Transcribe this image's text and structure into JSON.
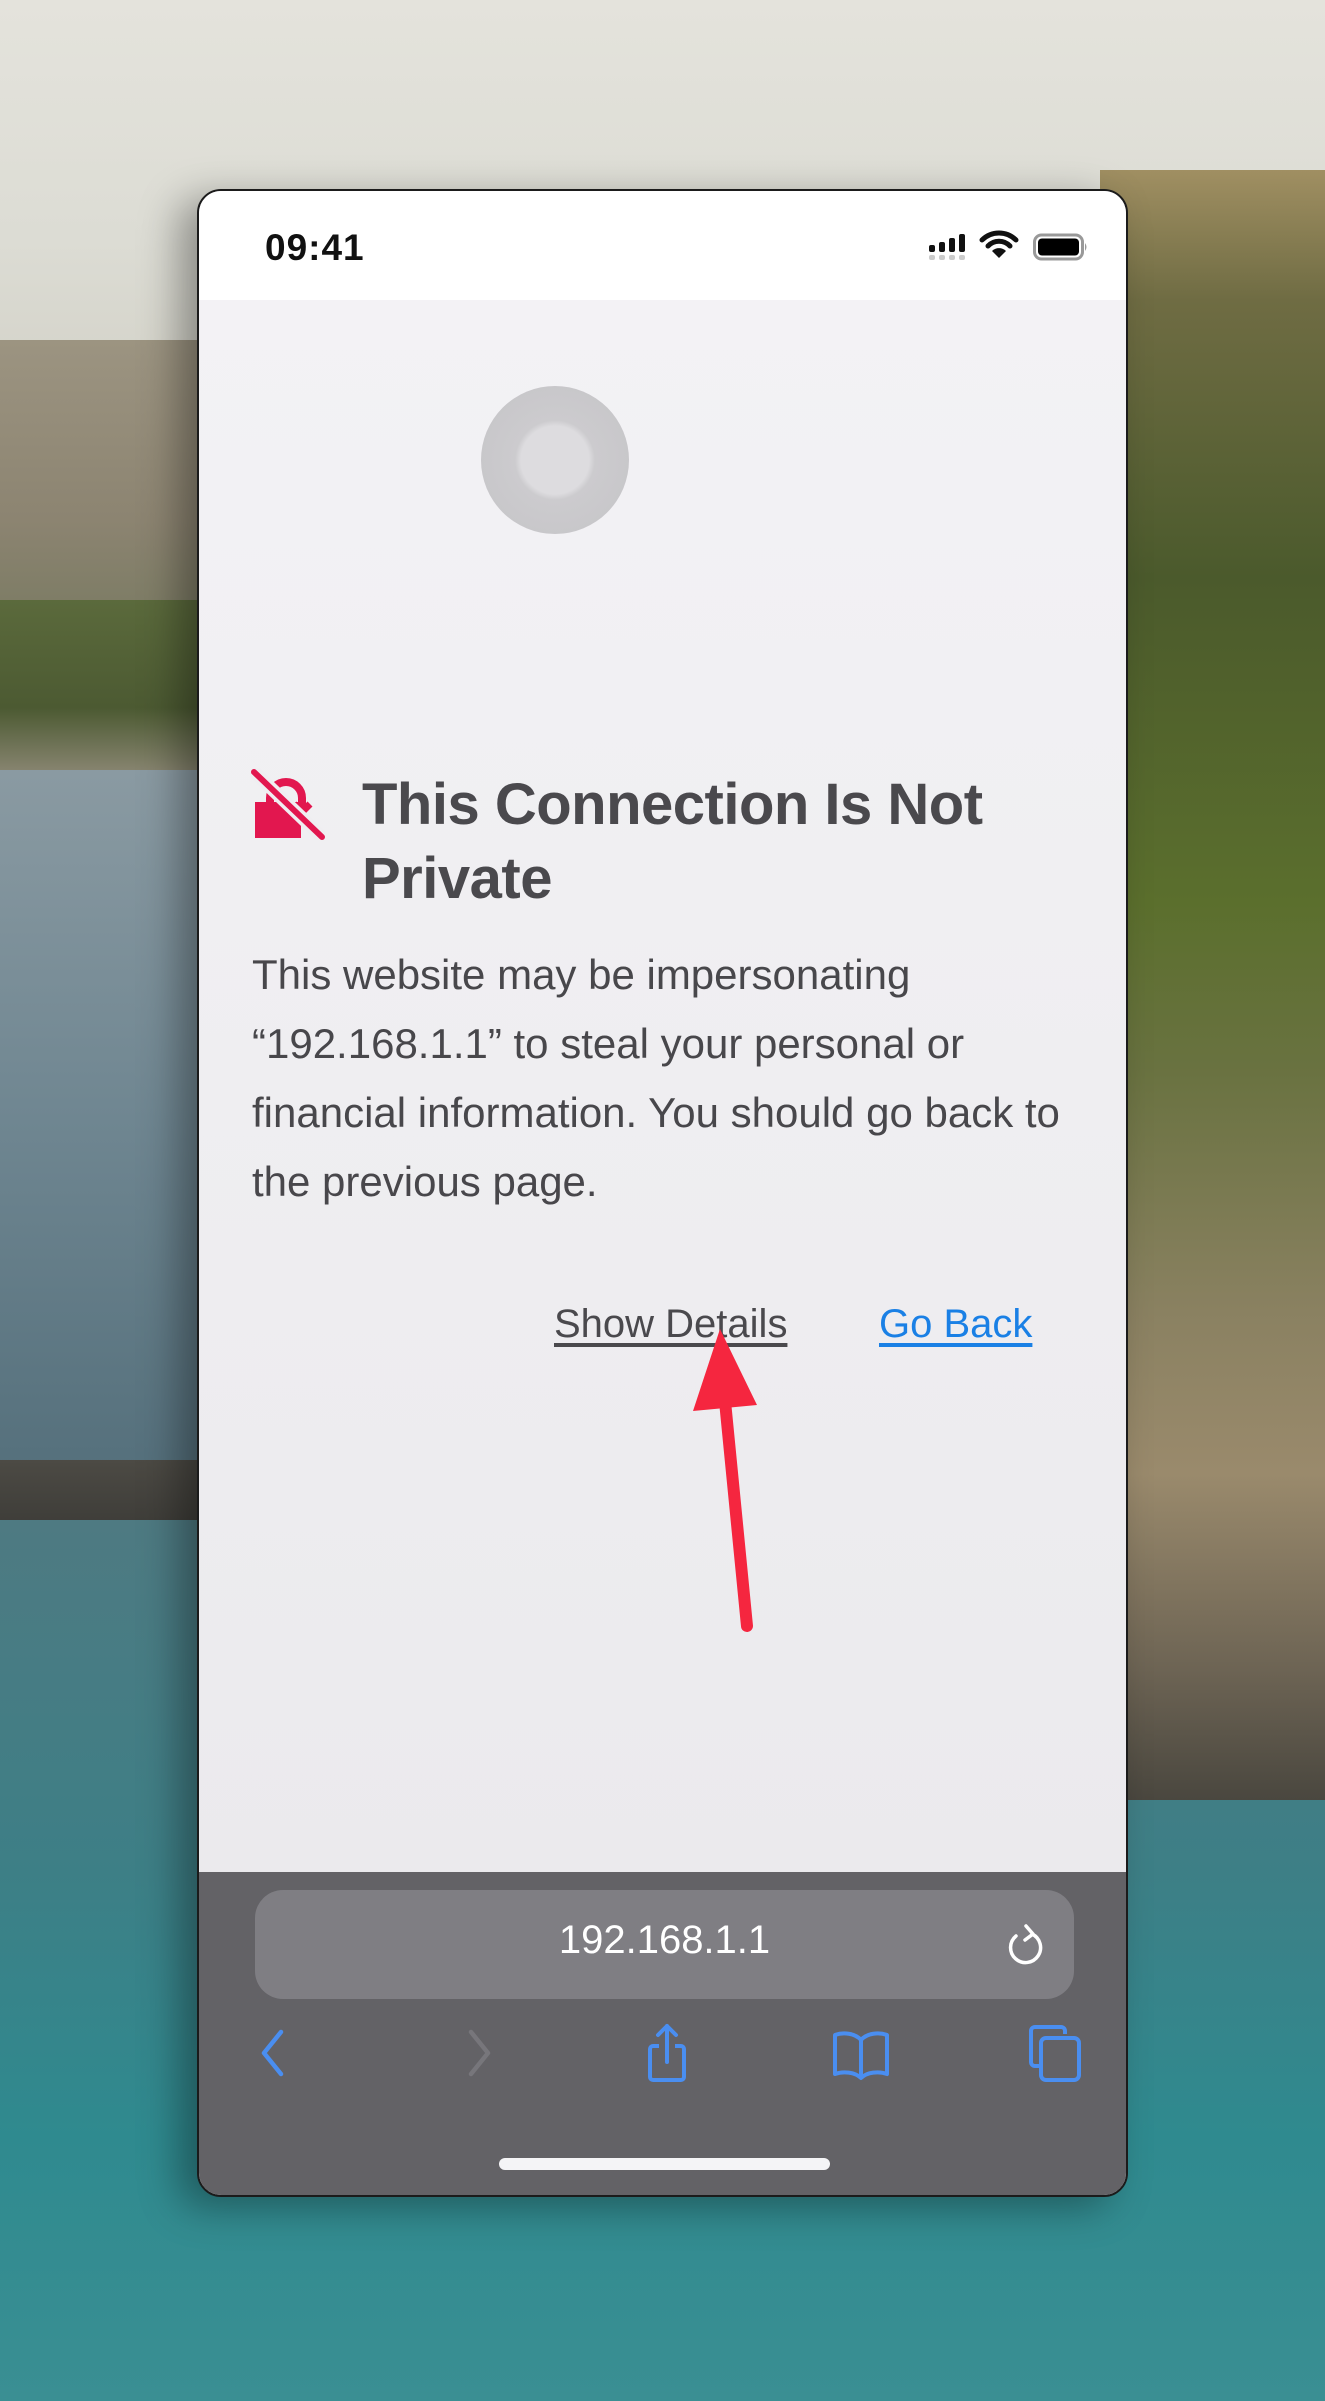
{
  "status_bar": {
    "time": "09:41",
    "icons": [
      "cellular-signal-icon",
      "wifi-icon",
      "battery-icon"
    ]
  },
  "page": {
    "warning_icon": "lock-slash-icon",
    "title": "This Connection Is Not Private",
    "body": "This website may be impersonating “192.168.1.1” to steal your personal or financial information. You should go back to the previous page.",
    "show_details_label": "Show Details",
    "go_back_label": "Go Back"
  },
  "toolbar": {
    "url": "192.168.1.1",
    "reload_icon": "reload-icon",
    "buttons": [
      {
        "name": "back",
        "icon": "chevron-left-icon",
        "enabled": true
      },
      {
        "name": "forward",
        "icon": "chevron-right-icon",
        "enabled": false
      },
      {
        "name": "share",
        "icon": "share-icon",
        "enabled": true
      },
      {
        "name": "bookmarks",
        "icon": "book-icon",
        "enabled": true
      },
      {
        "name": "tabs",
        "icon": "tabs-icon",
        "enabled": true
      }
    ]
  },
  "annotation": {
    "type": "arrow",
    "points_to": "Show Details",
    "color": "#f5263f"
  },
  "colors": {
    "accent": "#1a80e5",
    "warning": "#e2174f",
    "toolbar_icon": "#4a8ef0",
    "toolbar_bg": "#636266"
  }
}
